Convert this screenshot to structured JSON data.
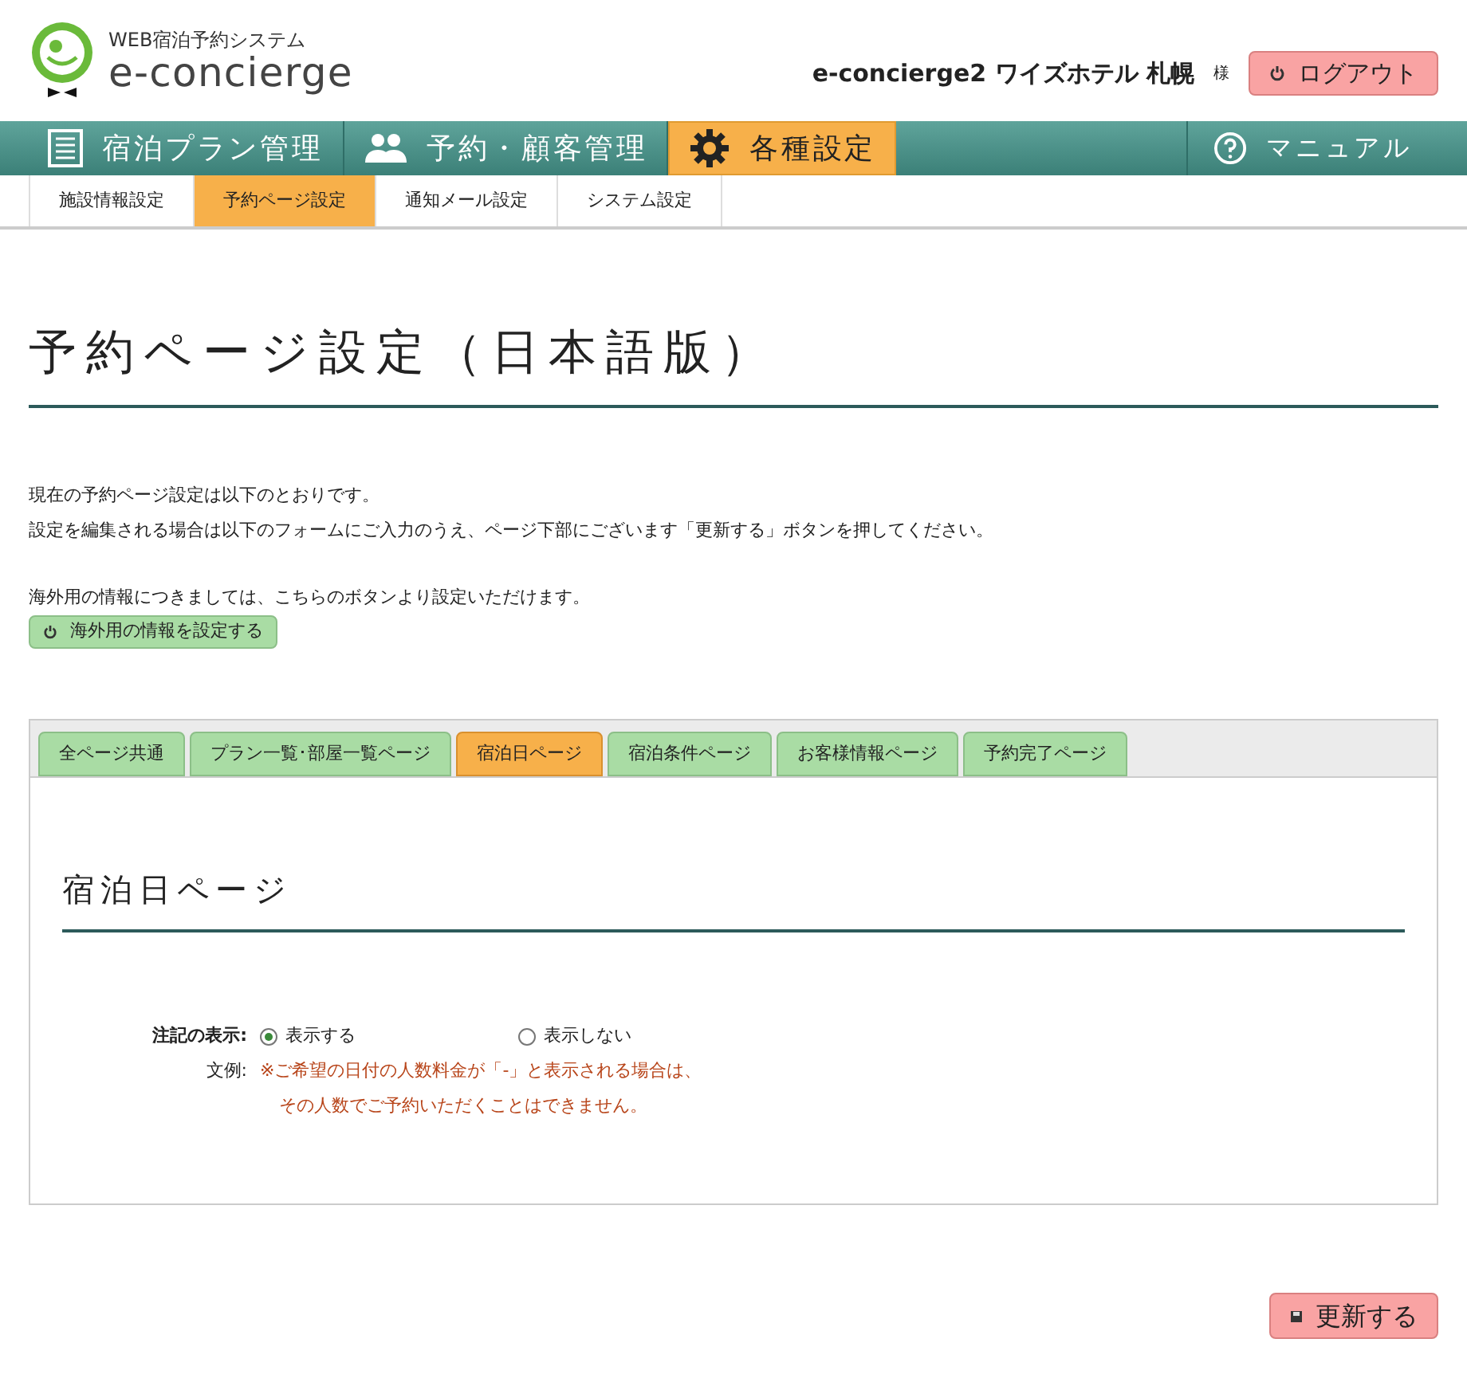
{
  "header": {
    "logo_caption": "WEB宿泊予約システム",
    "logo_text": "e-concierge",
    "account_name": "e-concierge2 ワイズホテル 札幌",
    "honorific": "様",
    "logout_button": "ログアウト"
  },
  "main_nav": [
    {
      "kind": "list",
      "label": "宿泊プラン管理",
      "selected": false
    },
    {
      "kind": "people",
      "label": "予約・顧客管理",
      "selected": false
    },
    {
      "kind": "gear",
      "label": "各種設定",
      "selected": true
    }
  ],
  "help_nav": {
    "label": "マニュアル"
  },
  "sub_nav": [
    {
      "label": "施設情報設定",
      "selected": false
    },
    {
      "label": "予約ページ設定",
      "selected": true
    },
    {
      "label": "通知メール設定",
      "selected": false
    },
    {
      "label": "システム設定",
      "selected": false
    }
  ],
  "page_title": "予約ページ設定（日本語版）",
  "intro": [
    "現在の予約ページ設定は以下のとおりです。",
    "設定を編集される場合は以下のフォームにご入力のうえ、ページ下部にございます「更新する」ボタンを押してください。"
  ],
  "overseas_note": "海外用の情報につきましては、こちらのボタンより設定いただけます。",
  "overseas_button": "海外用の情報を設定する",
  "page_tabs": [
    {
      "label": "全ページ共通",
      "selected": false
    },
    {
      "label": "プラン一覧･部屋一覧ページ",
      "selected": false
    },
    {
      "label": "宿泊日ページ",
      "selected": true
    },
    {
      "label": "宿泊条件ページ",
      "selected": false
    },
    {
      "label": "お客様情報ページ",
      "selected": false
    },
    {
      "label": "予約完了ページ",
      "selected": false
    }
  ],
  "section_title": "宿泊日ページ",
  "note_setting": {
    "label": "注記の表示:",
    "options": [
      {
        "label": "表示する",
        "selected": true
      },
      {
        "label": "表示しない",
        "selected": false
      }
    ]
  },
  "example": {
    "label": "文例:",
    "lines": [
      "※ご希望の日付の人数料金が「-」と表示される場合は、",
      "その人数でご予約いただくことはできません。"
    ]
  },
  "update_button": "更新する"
}
